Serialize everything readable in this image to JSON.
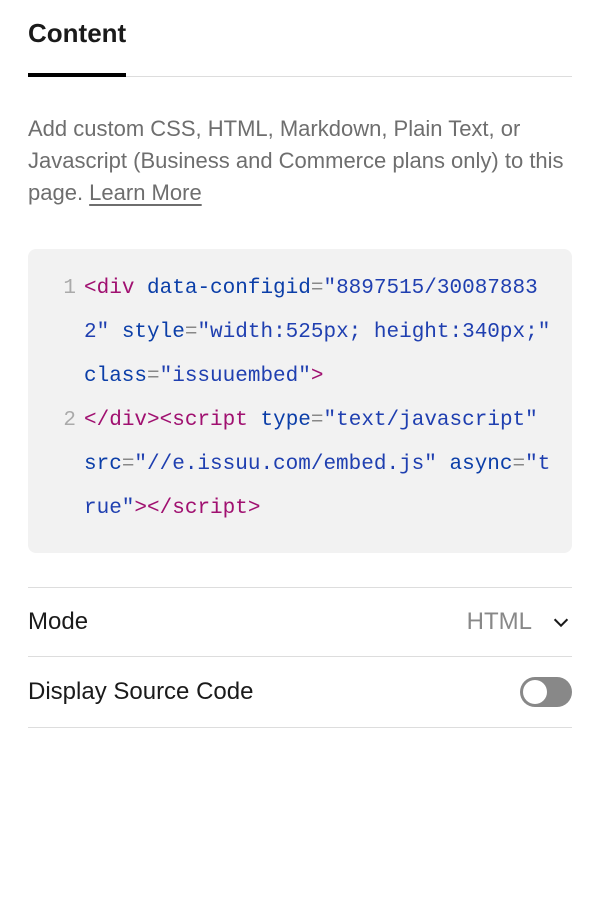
{
  "tab": {
    "label": "Content"
  },
  "description": {
    "text_before_link": "Add custom CSS, HTML, Markdown, Plain Text, or Javascript (Business and Commerce plans only) to this page. ",
    "link_text": "Learn More"
  },
  "code": {
    "line1_no": "1",
    "line2_no": "2",
    "l1_open": "<",
    "l1_tag": "div",
    "l1_sp": " ",
    "l1_attr1": "data-configid",
    "l1_eq": "=",
    "l1_val1": "\"8897515/300878832\"",
    "l1_sp2": " ",
    "l1_attr2": "style",
    "l1_val2": "\"width:525px; height:340px;\"",
    "l1_sp3": " ",
    "l1_attr3": "class",
    "l1_val3": "\"issuuembed\"",
    "l1_close": ">",
    "l2_closediv_open": "</",
    "l2_closediv_tag": "div",
    "l2_closediv_close": ">",
    "l2_script_open": "<",
    "l2_script_tag": "script",
    "l2_sp": " ",
    "l2_attr1": "type",
    "l2_val1": "\"text/javascript\"",
    "l2_sp2": " ",
    "l2_attr2": "src",
    "l2_val2": "\"//e.issuu.com/embed.js\"",
    "l2_sp3": " ",
    "l2_attr3": "async",
    "l2_val3": "\"true\"",
    "l2_gt": ">",
    "l2_endscript_open": "</",
    "l2_endscript_tag": "script",
    "l2_endscript_close": ">"
  },
  "mode": {
    "label": "Mode",
    "value": "HTML"
  },
  "display_source": {
    "label": "Display Source Code",
    "on": false
  }
}
